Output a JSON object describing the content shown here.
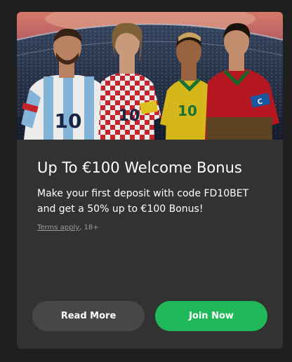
{
  "promo": {
    "title": "Up To €100 Welcome Bonus",
    "description": "Make your first deposit with code FD10BET and get a 50% up to €100 Bonus!",
    "terms_link": "Terms apply",
    "terms_suffix": ", 18+",
    "hero_image": {
      "subject": "four-footballers-in-stadium",
      "jerseys": [
        {
          "team": "argentina",
          "number": "10",
          "primary": "#8fc3ea",
          "secondary": "#ffffff"
        },
        {
          "team": "croatia",
          "number": "10",
          "primary": "#d8262e",
          "secondary": "#ffffff"
        },
        {
          "team": "brazil",
          "number": "10",
          "primary": "#e8c61e",
          "secondary": "#1d7a3a"
        },
        {
          "team": "portugal",
          "number": "",
          "primary": "#c41a22",
          "secondary": "#1b6f2e"
        }
      ]
    }
  },
  "actions": {
    "read_more": "Read More",
    "join_now": "Join Now"
  },
  "colors": {
    "page_background": "#1f1f1f",
    "card_background": "#323232",
    "secondary_button": "#474747",
    "primary_button": "#1fb95a",
    "terms_text": "#9a9a9a"
  }
}
